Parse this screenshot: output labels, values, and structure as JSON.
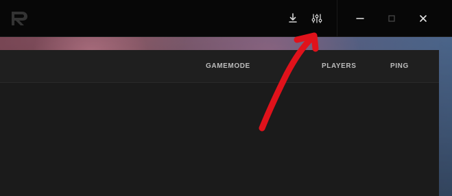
{
  "titlebar": {
    "actions": {
      "download_icon": "download-icon",
      "settings_icon": "sliders-icon"
    },
    "window_controls": {
      "minimize_icon": "minimize-icon",
      "maximize_icon": "maximize-icon",
      "close_icon": "close-icon"
    }
  },
  "server_list": {
    "columns": {
      "gamemode": "GAMEMODE",
      "players": "PLAYERS",
      "ping": "PING"
    }
  },
  "colors": {
    "titlebar_bg": "#070707",
    "panel_bg": "#1c1c1c",
    "header_text": "#bdbdbd",
    "annotation_red": "#e0121b"
  }
}
